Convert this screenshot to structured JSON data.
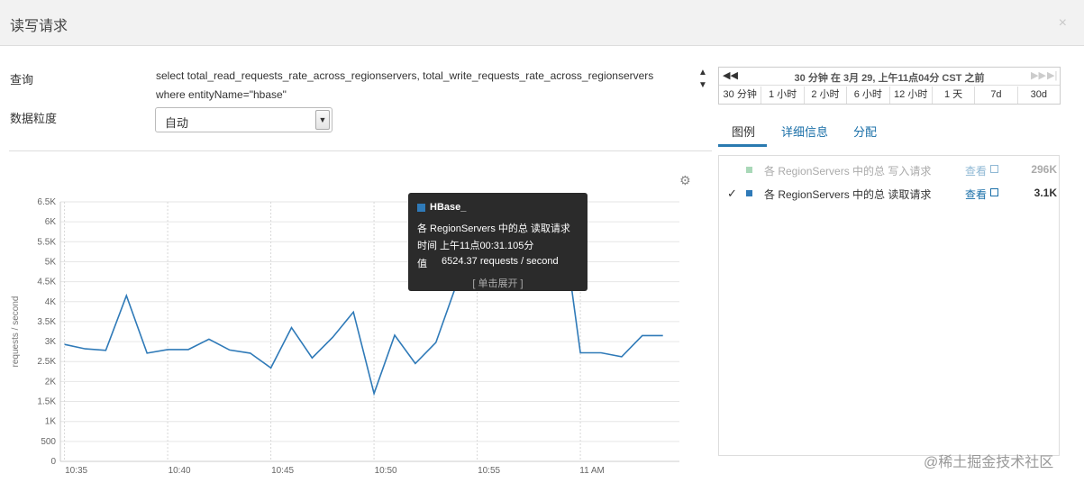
{
  "dialog": {
    "title": "读写请求",
    "close_icon": "×"
  },
  "query": {
    "label": "查询",
    "text": "select total_read_requests_rate_across_regionservers, total_write_requests_rate_across_regionservers where entityName=\"hbase\""
  },
  "granularity": {
    "label": "数据粒度",
    "selected": "自动"
  },
  "time_range": {
    "summary": "30 分钟 在 3月 29, 上午11点04分 CST 之前",
    "ranges": [
      "30 分钟",
      "1 小时",
      "2 小时",
      "6 小时",
      "12 小时",
      "1 天",
      "7d",
      "30d"
    ]
  },
  "tabs": [
    "图例",
    "详细信息",
    "分配"
  ],
  "legend": [
    {
      "checked": false,
      "name": "各 RegionServers 中的总 写入请求",
      "view": "查看",
      "total": "296K",
      "color": "#a9d8b8"
    },
    {
      "checked": true,
      "check_mark": "✓",
      "name": "各 RegionServers 中的总 读取请求",
      "view": "查看",
      "total": "3.1K",
      "color": "#2f7ab8"
    }
  ],
  "tooltip": {
    "header": "HBase_",
    "series": "各 RegionServers 中的总 读取请求",
    "time": "时间  上午11点00:31.105分",
    "value_label": "值",
    "value": "6524.37 requests / second",
    "expand": "[ 单击展开 ]"
  },
  "chart_data": {
    "type": "line",
    "ylabel": "requests / second",
    "ylim": [
      0,
      6500
    ],
    "y_ticks": [
      "0",
      "500",
      "1K",
      "1.5K",
      "2K",
      "2.5K",
      "3K",
      "3.5K",
      "4K",
      "4.5K",
      "5K",
      "5.5K",
      "6K",
      "6.5K"
    ],
    "x_ticks": [
      "10:35",
      "10:40",
      "10:45",
      "10:50",
      "10:55",
      "11 AM"
    ],
    "series": [
      {
        "color": "#2f7ab8",
        "x": [
          0.2,
          1.2,
          2.2,
          3.2,
          4.2,
          5.2,
          6.2,
          7.2,
          8.2,
          9.2,
          10.2,
          11.2,
          12.2,
          13.2,
          14.2,
          15.2,
          16.2,
          17.2,
          18.2,
          19.2,
          20.2,
          21.2,
          22.2,
          23.2,
          24.2,
          25.2,
          26.2,
          27.2,
          28.2,
          29.2
        ],
        "values": [
          2930,
          2820,
          2780,
          4150,
          2710,
          2800,
          2800,
          3060,
          2790,
          2710,
          2340,
          3350,
          2590,
          3110,
          3740,
          1700,
          3160,
          2450,
          2980,
          4440,
          5440,
          4940,
          5960,
          5440,
          6524,
          2720,
          2720,
          2620,
          3150,
          3150
        ]
      }
    ]
  },
  "watermark": "@稀土掘金技术社区"
}
